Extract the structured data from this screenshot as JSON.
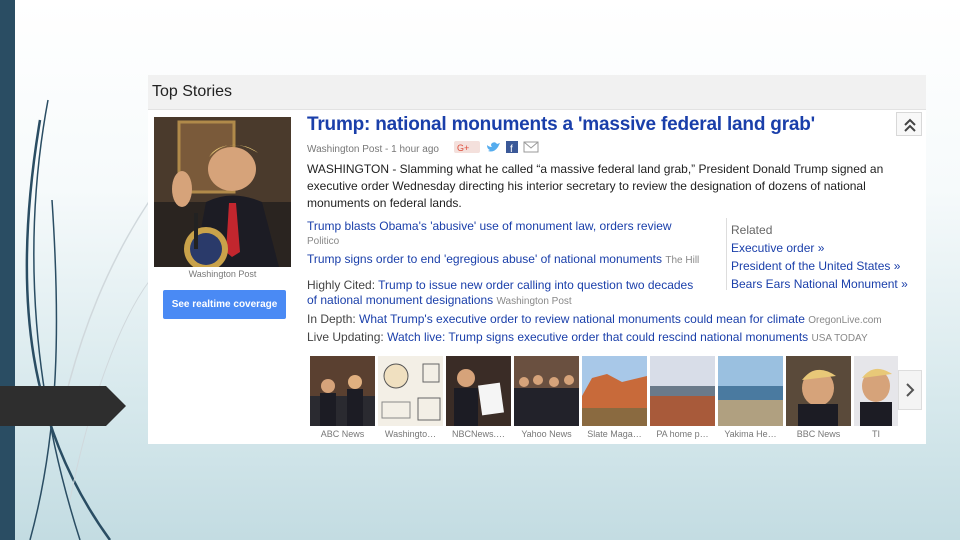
{
  "panel": {
    "title": "Top Stories"
  },
  "lead": {
    "headline": "Trump: national monuments a 'massive federal land grab'",
    "source": "Washington Post",
    "age": "1 hour ago",
    "snippet": "WASHINGTON - Slamming what he called “a massive federal land grab,” President Donald Trump signed an executive order Wednesday directing his interior secretary to review the designation of dozens of national monuments on federal lands.",
    "photo_caption": "Washington Post",
    "realtime_label": "See realtime coverage"
  },
  "stories": [
    {
      "title": "Trump blasts Obama's 'abusive' use of monument law, orders review",
      "source": "Politico"
    },
    {
      "title": "Trump signs order to end 'egregious abuse' of national monuments",
      "source": "The Hill"
    }
  ],
  "highly_cited": {
    "label": "Highly Cited:",
    "title_line1": "Trump to issue new order calling into question two decades",
    "title_line2": "of national monument designations",
    "source": "Washington Post"
  },
  "in_depth": {
    "label": "In Depth:",
    "title": "What Trump's executive order to review national monuments could mean for climate",
    "source": "OregonLive.com"
  },
  "live_updating": {
    "label": "Live Updating:",
    "title": "Watch live: Trump signs executive order that could rescind national monuments",
    "source": "USA TODAY"
  },
  "related": {
    "header": "Related",
    "items": [
      "Executive order »",
      "President of the United States »",
      "Bears Ears National Monument »"
    ]
  },
  "thumbnails": [
    "ABC News",
    "Washingto…",
    "NBCNews.…",
    "Yahoo News",
    "Slate Maga…",
    "PA home p…",
    "Yakima He…",
    "BBC News",
    "TI"
  ],
  "icons": [
    "google-plus-icon",
    "twitter-icon",
    "facebook-icon",
    "email-icon",
    "chevron-up-double-icon",
    "chevron-right-icon"
  ],
  "colors": {
    "link": "#1a3faa",
    "button": "#4a8af4",
    "sidebar": "#2a4d63"
  }
}
